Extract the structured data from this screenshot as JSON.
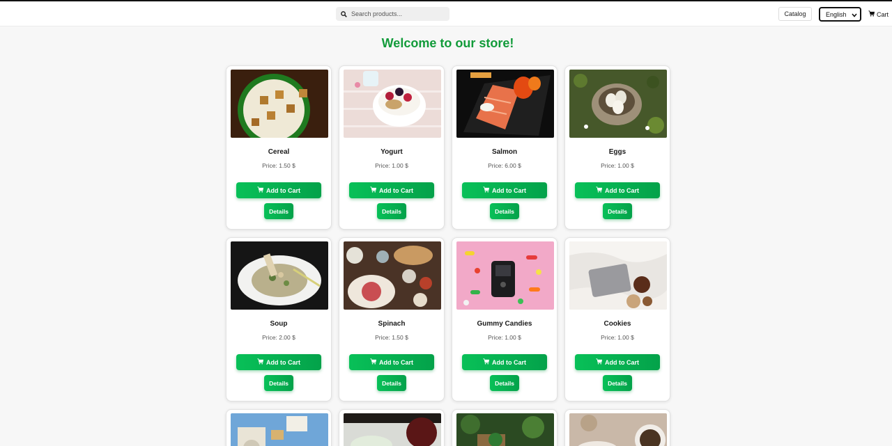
{
  "header": {
    "search_placeholder": "Search products...",
    "catalog_label": "Catalog",
    "language_selected": "English",
    "cart_label": "Cart"
  },
  "main": {
    "title": "Welcome to our store!",
    "add_to_cart_label": "Add to Cart",
    "details_label": "Details",
    "products": [
      {
        "name": "Cereal",
        "price": "Price: 1.50 $"
      },
      {
        "name": "Yogurt",
        "price": "Price: 1.00 $"
      },
      {
        "name": "Salmon",
        "price": "Price: 6.00 $"
      },
      {
        "name": "Eggs",
        "price": "Price: 1.00 $"
      },
      {
        "name": "Soup",
        "price": "Price: 2.00 $"
      },
      {
        "name": "Spinach",
        "price": "Price: 1.50 $"
      },
      {
        "name": "Gummy Candies",
        "price": "Price: 1.00 $"
      },
      {
        "name": "Cookies",
        "price": "Price: 1.00 $"
      }
    ]
  },
  "colors": {
    "brand_green": "#129b3a",
    "button_green": "#08c058",
    "background": "#f7f7f7"
  },
  "icons": [
    "search-icon",
    "cart-icon",
    "chevron-down-icon"
  ]
}
